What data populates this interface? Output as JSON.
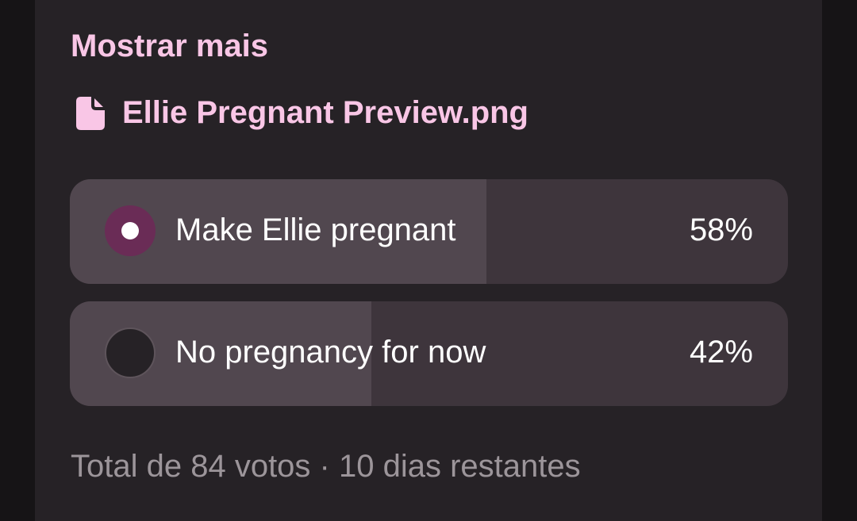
{
  "post": {
    "show_more_label": "Mostrar mais",
    "attachment": {
      "icon": "file-icon",
      "filename": "Ellie Pregnant Preview.png"
    }
  },
  "poll": {
    "options": [
      {
        "label": "Make Ellie pregnant",
        "percent": "58%",
        "fraction": 0.58,
        "selected": true
      },
      {
        "label": "No pregnancy for now",
        "percent": "42%",
        "fraction": 0.42,
        "selected": false
      }
    ],
    "footer": {
      "total_votes": "Total de 84 votos",
      "separator": "·",
      "time_left": "10 dias restantes"
    }
  },
  "colors": {
    "accent_pink": "#f9c6e6",
    "selected_radio": "#6a2c56"
  }
}
